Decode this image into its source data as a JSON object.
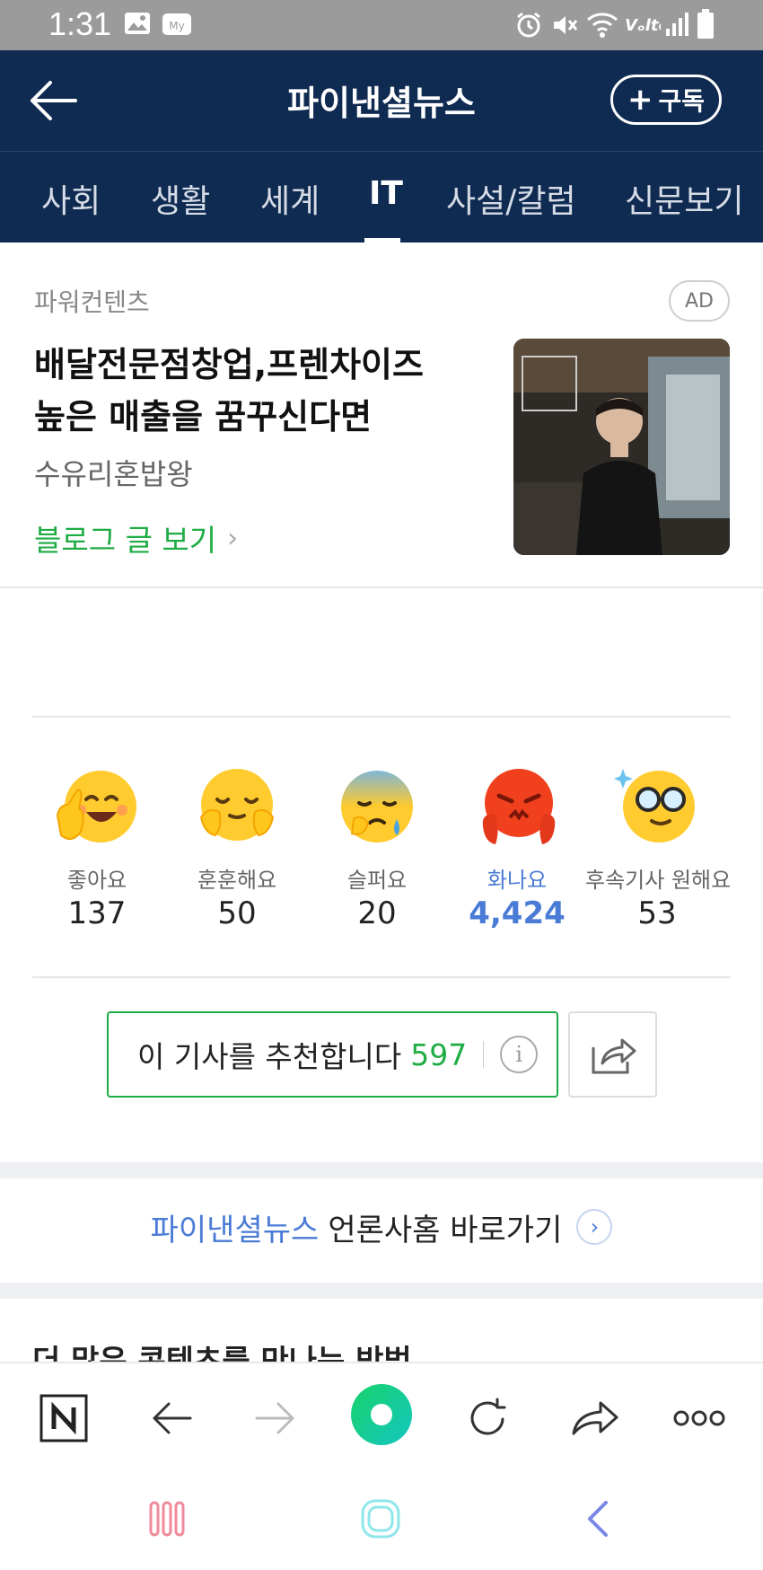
{
  "status_bar": {
    "time": "1:31",
    "icons": [
      "gallery-icon",
      "mobile-carrier-icon",
      "alarm-icon",
      "mute-icon",
      "wifi-icon",
      "volte-icon",
      "signal-icon",
      "battery-icon"
    ]
  },
  "header": {
    "title": "파이낸셜뉴스",
    "subscribe_label": "구독"
  },
  "tabs": [
    {
      "label": "사회",
      "active": false
    },
    {
      "label": "생활",
      "active": false
    },
    {
      "label": "세계",
      "active": false
    },
    {
      "label": "IT",
      "active": true
    },
    {
      "label": "사설/칼럼",
      "active": false
    },
    {
      "label": "신문보기",
      "active": false
    }
  ],
  "ad": {
    "section_label": "파워컨텐츠",
    "badge": "AD",
    "headline_line1": "배달전문점창업,프렌차이즈",
    "headline_line2": "높은 매출을 꿈꾸신다면",
    "advertiser": "수유리혼밥왕",
    "cta": "블로그 글 보기"
  },
  "reactions": [
    {
      "label": "좋아요",
      "count": "137",
      "highlighted": false
    },
    {
      "label": "훈훈해요",
      "count": "50",
      "highlighted": false
    },
    {
      "label": "슬퍼요",
      "count": "20",
      "highlighted": false
    },
    {
      "label": "화나요",
      "count": "4,424",
      "highlighted": true
    },
    {
      "label": "후속기사 원해요",
      "count": "53",
      "highlighted": false
    }
  ],
  "recommend": {
    "label": "이 기사를 추천합니다",
    "count": "597"
  },
  "press_link": {
    "press_name": "파이낸셜뉴스",
    "label": "언론사홈 바로가기"
  },
  "more_section": {
    "title": "더 많은 콘텐츠를 만나는 방법"
  },
  "colors": {
    "header_bg": "#102b52",
    "accent_green": "#1fac44",
    "accent_blue": "#4a7bd6",
    "status_bar_bg": "#9b9b9b"
  }
}
